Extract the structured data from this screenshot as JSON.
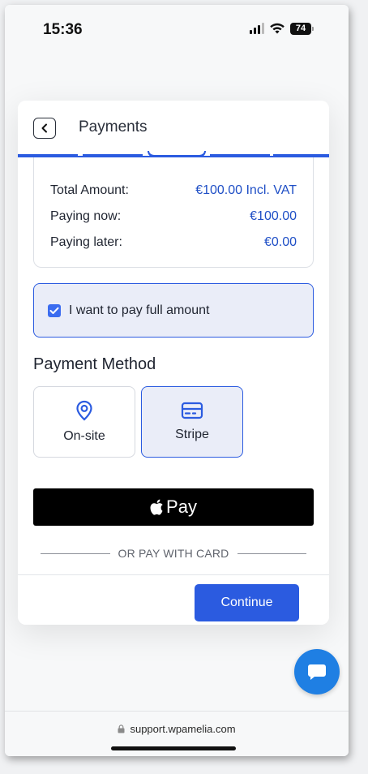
{
  "status_bar": {
    "time": "15:36",
    "battery": "74",
    "icons": [
      "signal-icon",
      "wifi-icon",
      "battery-icon"
    ]
  },
  "modal": {
    "title": "Payments",
    "back_icon": "chevron-left-icon",
    "progress_steps": 5,
    "active_step": 3
  },
  "summary": {
    "rows": [
      {
        "label": "Total Amount:",
        "value": "€100.00 Incl. VAT"
      },
      {
        "label": "Paying now:",
        "value": "€100.00"
      },
      {
        "label": "Paying later:",
        "value": "€0.00"
      }
    ]
  },
  "full_amount": {
    "label": "I want to pay full amount",
    "checked": true
  },
  "payment_method": {
    "title": "Payment Method",
    "options": [
      {
        "label": "On-site",
        "icon": "location-pin-icon",
        "selected": false
      },
      {
        "label": "Stripe",
        "icon": "credit-card-icon",
        "selected": true
      }
    ]
  },
  "apple_pay": {
    "label": "Pay",
    "icon": "apple-logo-icon"
  },
  "divider_text": "OR PAY WITH CARD",
  "footer": {
    "continue_label": "Continue"
  },
  "chat": {
    "icon": "chat-bubble-icon"
  },
  "browser": {
    "url": "support.wpamelia.com",
    "lock_icon": "lock-icon"
  },
  "colors": {
    "accent": "#2b5be0",
    "value_text": "#1f4fc6",
    "selected_bg": "#eaedf8",
    "apple_pay_bg": "#000000",
    "chat_fab": "#1f7fe3"
  }
}
